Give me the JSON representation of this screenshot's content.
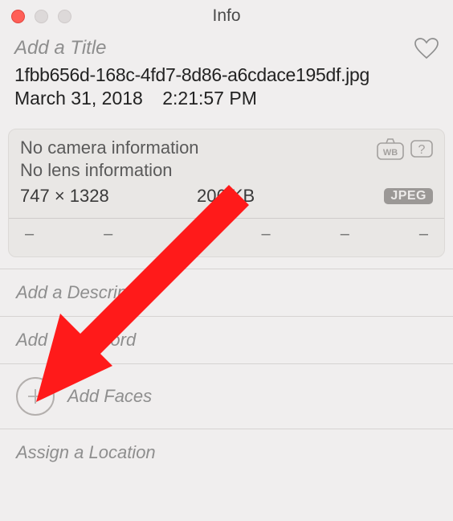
{
  "window": {
    "title": "Info"
  },
  "header": {
    "title_placeholder": "Add a Title",
    "filename": "1fbb656d-168c-4fd7-8d86-a6cdace195df.jpg",
    "date": "March 31, 2018",
    "time": "2:21:57 PM"
  },
  "camera": {
    "camera_info": "No camera information",
    "lens_info": "No lens information",
    "dimensions": "747 × 1328",
    "file_size": "206 KB",
    "format_badge": "JPEG",
    "exif_slots": [
      "–",
      "–",
      "–",
      "–",
      "–",
      "–"
    ]
  },
  "sections": {
    "description_placeholder": "Add a Description",
    "keyword_placeholder": "Add a Keyword",
    "faces_label": "Add Faces",
    "location_placeholder": "Assign a Location"
  }
}
